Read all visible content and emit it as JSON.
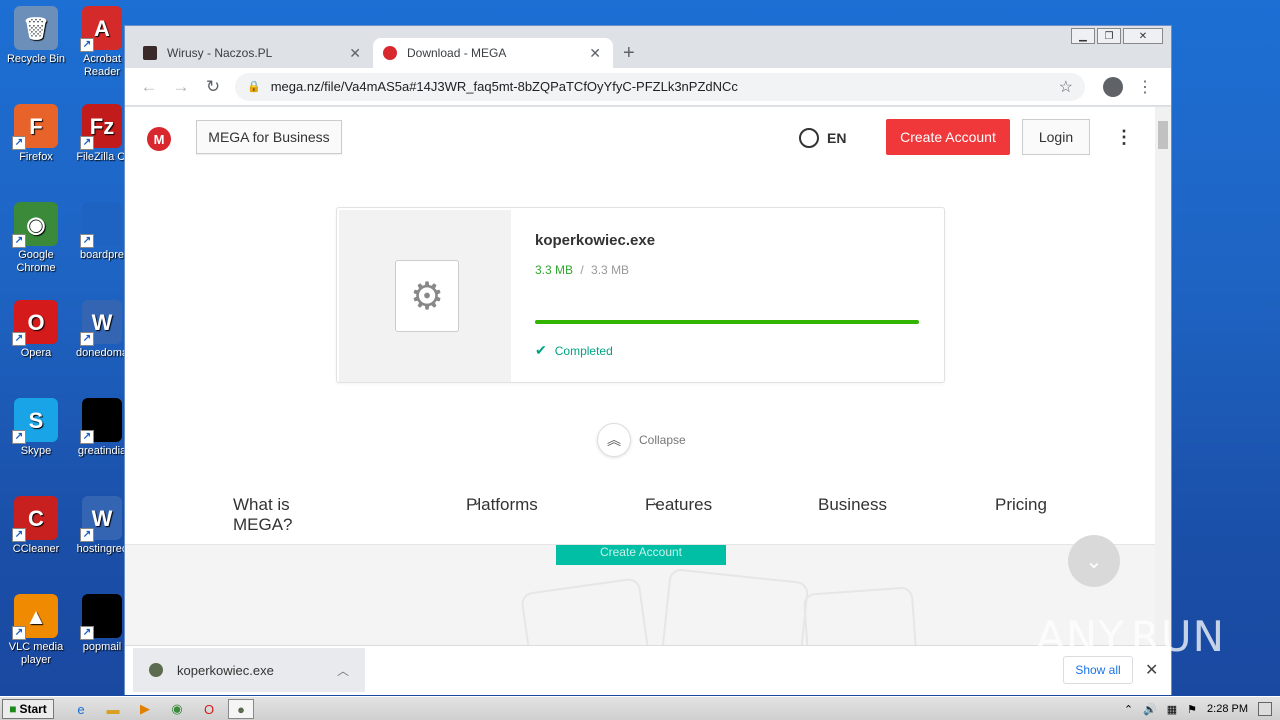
{
  "desktop": {
    "icons": [
      {
        "label": "Recycle Bin",
        "color": "#6b8fb8",
        "glyph": "🗑"
      },
      {
        "label": "Acrobat Reader",
        "color": "#d42a2a",
        "glyph": "A"
      },
      {
        "label": "Firefox",
        "color": "#e8632a",
        "glyph": "F"
      },
      {
        "label": "FileZilla Cl",
        "color": "#c11b1b",
        "glyph": "Fz"
      },
      {
        "label": "Google Chrome",
        "color": "#3a8a3a",
        "glyph": "◉"
      },
      {
        "label": "boardpre",
        "color": "#1e63c2",
        "glyph": ""
      },
      {
        "label": "Opera",
        "color": "#d41a1a",
        "glyph": "O"
      },
      {
        "label": "donedoma",
        "color": "#3465b2",
        "glyph": "W"
      },
      {
        "label": "Skype",
        "color": "#1aa4e8",
        "glyph": "S"
      },
      {
        "label": "greatindia",
        "color": "#000000",
        "glyph": ""
      },
      {
        "label": "CCleaner",
        "color": "#c8201f",
        "glyph": "C"
      },
      {
        "label": "hostingrec",
        "color": "#3465b2",
        "glyph": "W"
      },
      {
        "label": "VLC media player",
        "color": "#f08a00",
        "glyph": "▲"
      },
      {
        "label": "popmail",
        "color": "#000000",
        "glyph": ""
      }
    ]
  },
  "browser": {
    "tabs": [
      {
        "title": "Wirusy - Naczos.PL",
        "fav_color": "#3a2a2a"
      },
      {
        "title": "Download - MEGA",
        "fav_color": "#d9272e"
      }
    ],
    "url": "mega.nz/file/Va4mAS5a#14J3WR_faq5mt-8bZQPaTCfOyYfyC-PFZLk3nPZdNCc"
  },
  "mega": {
    "logo": "M",
    "business_label": "MEGA for Business",
    "lang": "EN",
    "create_account": "Create Account",
    "login": "Login",
    "file": {
      "name": "koperkowiec.exe",
      "downloaded": "3.3 MB",
      "separator": "/",
      "total": "3.3 MB",
      "progress": 1.0,
      "status": "Completed"
    },
    "collapse": "Collapse",
    "nav": [
      {
        "label": "What is MEGA?",
        "dropdown": false
      },
      {
        "label": "Platforms",
        "dropdown": true
      },
      {
        "label": "Features",
        "dropdown": true
      },
      {
        "label": "Business",
        "dropdown": false
      },
      {
        "label": "Pricing",
        "dropdown": false
      }
    ],
    "lower_button": "Create Account"
  },
  "shelf": {
    "item": "koperkowiec.exe",
    "show_all": "Show all"
  },
  "taskbar": {
    "start": "Start",
    "time": "2:28 PM"
  },
  "watermark": "ANY.RUN"
}
